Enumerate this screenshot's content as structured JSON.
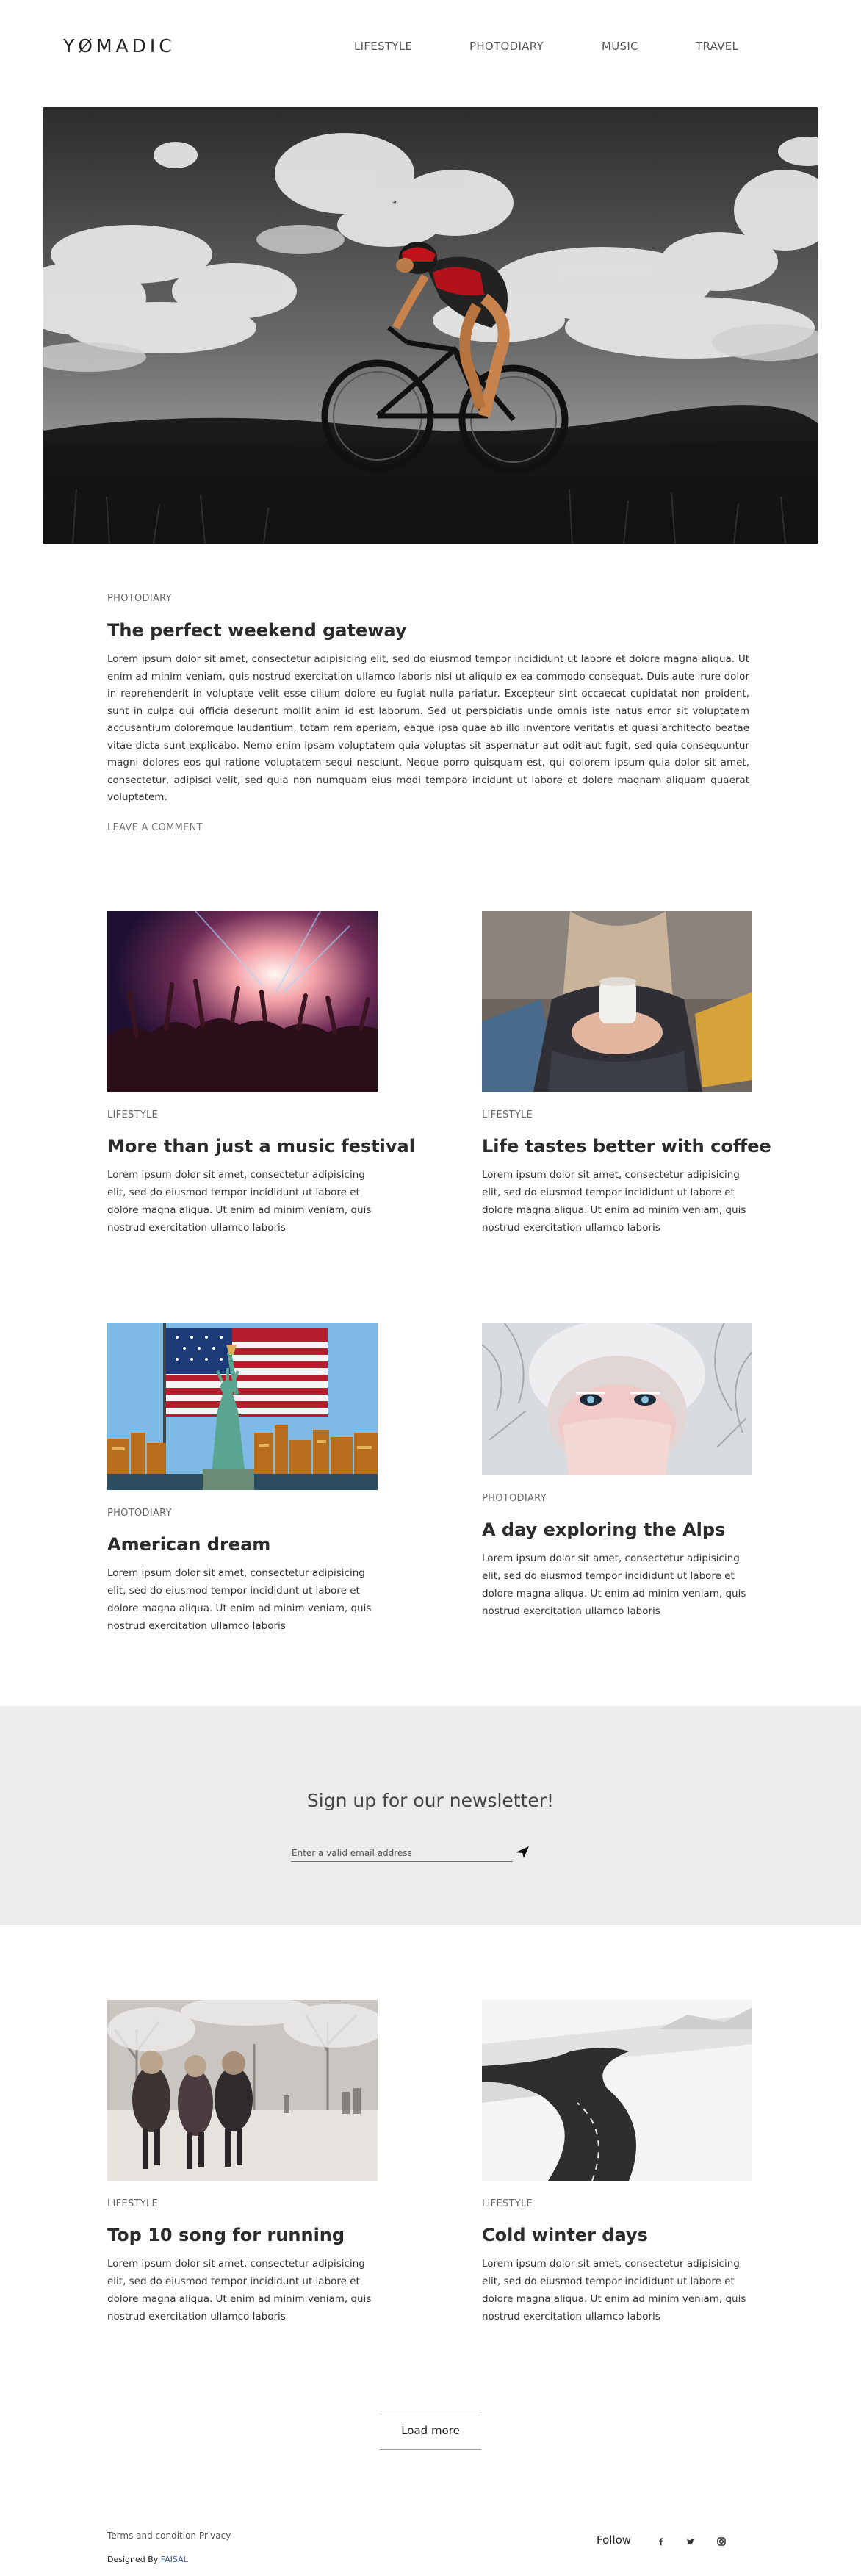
{
  "header": {
    "logo": "YØMADIC",
    "nav": [
      "LIFESTYLE",
      "PHOTODIARY",
      "MUSIC",
      "TRAVEL"
    ]
  },
  "hero": {
    "alt": "Cyclist on a racing bike under a cloudy sky"
  },
  "featured": {
    "category": "PHOTODIARY",
    "title": "The perfect weekend gateway",
    "body": "Lorem ipsum dolor sit amet, consectetur adipisicing elit, sed do eiusmod tempor incididunt ut labore et dolore magna aliqua. Ut enim ad minim veniam, quis nostrud exercitation ullamco laboris nisi ut aliquip ex ea commodo consequat. Duis aute irure dolor in reprehenderit in voluptate velit esse cillum dolore eu fugiat nulla pariatur. Excepteur sint occaecat cupidatat non proident, sunt in culpa qui officia deserunt mollit anim id est laborum. Sed ut perspiciatis unde omnis iste natus error sit voluptatem accusantium doloremque laudantium, totam rem aperiam, eaque ipsa quae ab illo inventore veritatis et quasi architecto beatae vitae dicta sunt explicabo. Nemo enim ipsam voluptatem quia voluptas sit aspernatur aut odit aut fugit, sed quia consequuntur magni dolores eos qui ratione voluptatem sequi nesciunt. Neque porro quisquam est, qui dolorem ipsum quia dolor sit amet, consectetur, adipisci velit, sed quia non numquam eius modi tempora incidunt ut labore et dolore magnam aliquam quaerat voluptatem.",
    "leave_comment": "LEAVE A COMMENT"
  },
  "posts": [
    {
      "category": "LIFESTYLE",
      "title": "More than just a music festival",
      "excerpt": "Lorem ipsum dolor sit amet, consectetur adipisicing elit, sed do eiusmod tempor incididunt ut labore et dolore magna aliqua. Ut enim ad minim veniam, quis nostrud exercitation ullamco laboris"
    },
    {
      "category": "LIFESTYLE",
      "title": "Life tastes better with coffee",
      "excerpt": "Lorem ipsum dolor sit amet, consectetur adipisicing elit, sed do eiusmod tempor incididunt ut labore et dolore magna aliqua. Ut enim ad minim veniam, quis nostrud exercitation ullamco laboris"
    },
    {
      "category": "PHOTODIARY",
      "title": "American dream",
      "excerpt": "Lorem ipsum dolor sit amet, consectetur adipisicing elit, sed do eiusmod tempor incididunt ut labore et dolore magna aliqua. Ut enim ad minim veniam, quis nostrud exercitation ullamco laboris"
    },
    {
      "category": "PHOTODIARY",
      "title": "A day exploring the Alps",
      "excerpt": "Lorem ipsum dolor sit amet, consectetur adipisicing elit, sed do eiusmod tempor incididunt ut labore et dolore magna aliqua. Ut enim ad minim veniam, quis nostrud exercitation ullamco laboris"
    },
    {
      "category": "LIFESTYLE",
      "title": "Top 10 song for running",
      "excerpt": "Lorem ipsum dolor sit amet, consectetur adipisicing elit, sed do eiusmod tempor incididunt ut labore et dolore magna aliqua. Ut enim ad minim veniam, quis nostrud exercitation ullamco laboris"
    },
    {
      "category": "LIFESTYLE",
      "title": "Cold winter days",
      "excerpt": "Lorem ipsum dolor sit amet, consectetur adipisicing elit, sed do eiusmod tempor incididunt ut labore et dolore magna aliqua. Ut enim ad minim veniam, quis nostrud exercitation ullamco laboris"
    }
  ],
  "newsletter": {
    "heading": "Sign up for our newsletter!",
    "placeholder": "Enter a valid email address"
  },
  "load_more": "Load more",
  "footer": {
    "terms": "Terms and condition",
    "privacy": "Privacy",
    "designed_by": "Designed By",
    "author": "FAISAL",
    "follow": "Follow",
    "social_icons": [
      "facebook-icon",
      "twitter-icon",
      "instagram-icon"
    ]
  }
}
